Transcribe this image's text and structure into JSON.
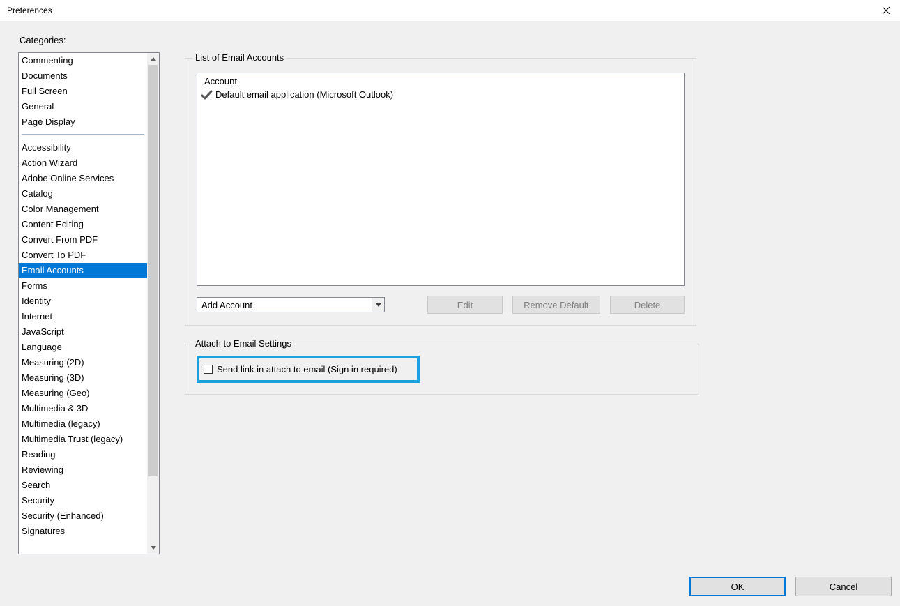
{
  "window": {
    "title": "Preferences"
  },
  "sidebar": {
    "label": "Categories:",
    "group1": [
      "Commenting",
      "Documents",
      "Full Screen",
      "General",
      "Page Display"
    ],
    "group2": [
      "Accessibility",
      "Action Wizard",
      "Adobe Online Services",
      "Catalog",
      "Color Management",
      "Content Editing",
      "Convert From PDF",
      "Convert To PDF",
      "Email Accounts",
      "Forms",
      "Identity",
      "Internet",
      "JavaScript",
      "Language",
      "Measuring (2D)",
      "Measuring (3D)",
      "Measuring (Geo)",
      "Multimedia & 3D",
      "Multimedia (legacy)",
      "Multimedia Trust (legacy)",
      "Reading",
      "Reviewing",
      "Search",
      "Security",
      "Security (Enhanced)",
      "Signatures"
    ],
    "selected": "Email Accounts"
  },
  "emailPane": {
    "listLabel": "List of Email Accounts",
    "accountHeader": "Account",
    "defaultEntry": "Default email application (Microsoft Outlook)",
    "addAccount": "Add Account",
    "editBtn": "Edit",
    "removeBtn": "Remove Default",
    "deleteBtn": "Delete"
  },
  "attach": {
    "label": "Attach to Email Settings",
    "checkboxLabel": "Send link in attach to email (Sign in required)"
  },
  "buttons": {
    "ok": "OK",
    "cancel": "Cancel"
  }
}
